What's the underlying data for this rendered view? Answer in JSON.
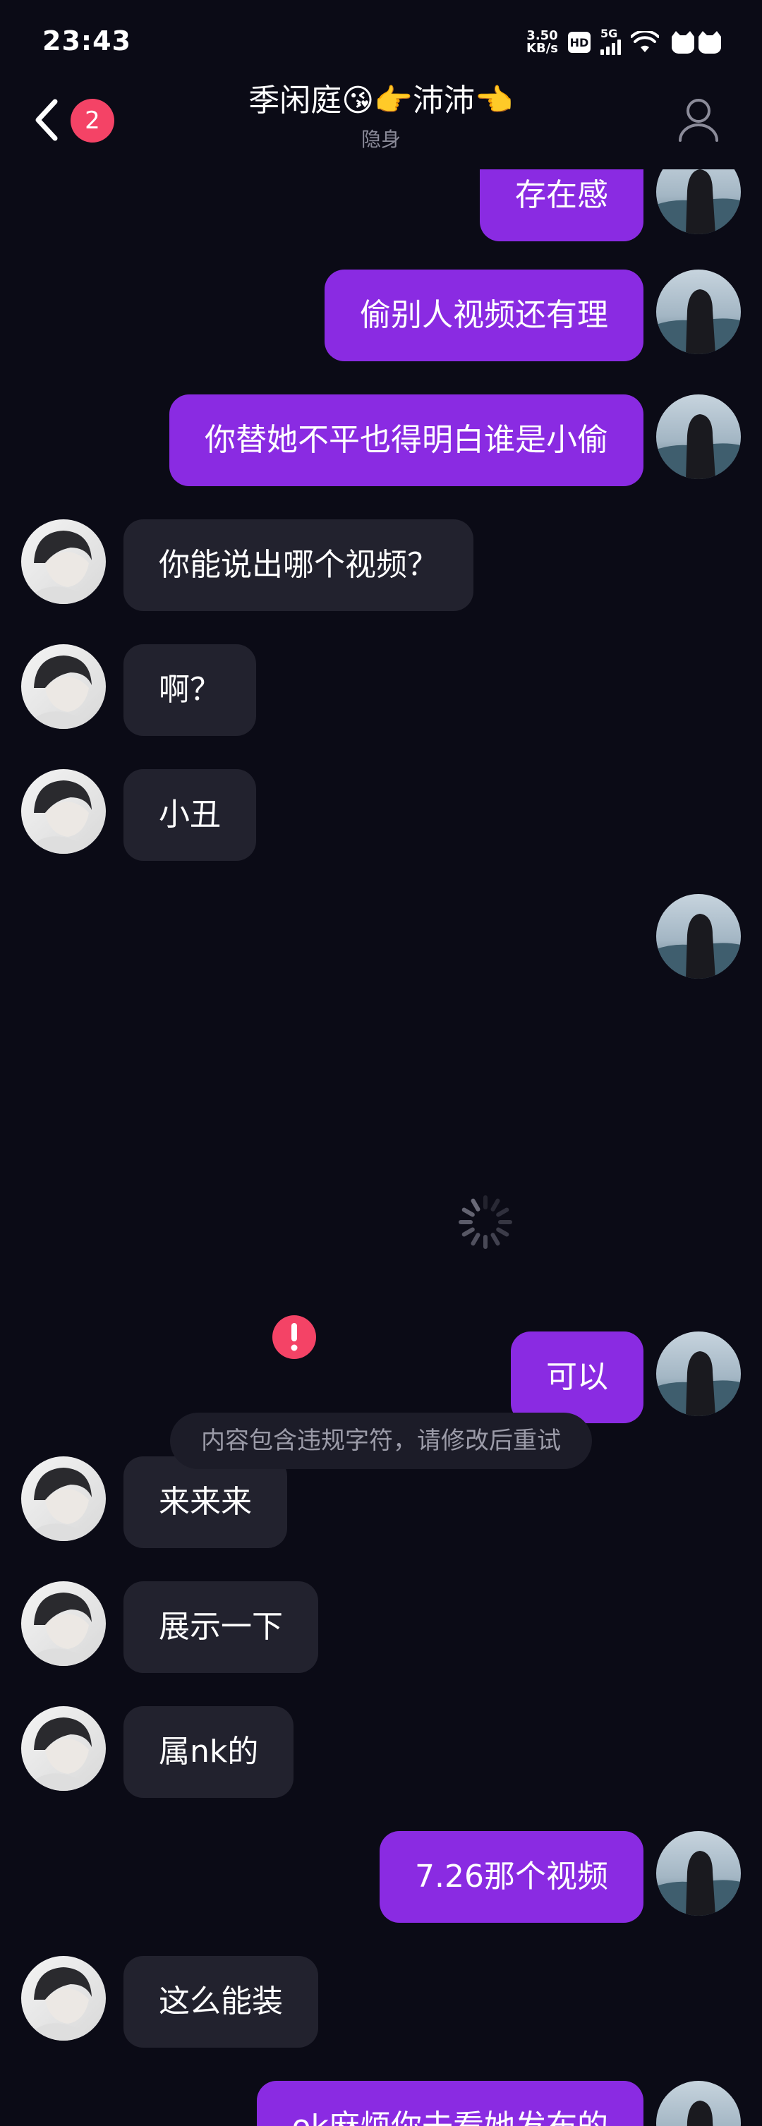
{
  "status_bar": {
    "time": "23:43",
    "net_speed_value": "3.50",
    "net_speed_unit": "KB/s",
    "hd_label": "HD",
    "network_type": "5G"
  },
  "header": {
    "unread_count": "2",
    "title": "季闲庭😘👉沛沛👈",
    "subtitle": "隐身"
  },
  "messages": [
    {
      "from": "self",
      "text": "存在感"
    },
    {
      "from": "self",
      "text": "偷别人视频还有理"
    },
    {
      "from": "self",
      "text": "你替她不平也得明白谁是小偷"
    },
    {
      "from": "other",
      "text": "你能说出哪个视频？"
    },
    {
      "from": "other",
      "text": "啊？"
    },
    {
      "from": "other",
      "text": "小丑"
    },
    {
      "from": "self",
      "text": "可以"
    },
    {
      "from": "other",
      "text": "来来来"
    },
    {
      "from": "other",
      "text": "展示一下"
    },
    {
      "from": "other",
      "text": "属nk的"
    },
    {
      "from": "self",
      "text": "7.26那个视频"
    },
    {
      "from": "other",
      "text": "这么能装"
    },
    {
      "from": "self",
      "text": "ok麻烦你去看她发布的"
    }
  ],
  "system_notice": "内容包含违规字符，请修改后重试",
  "colors": {
    "background": "#0b0b16",
    "self_bubble": "#8a2be2",
    "other_bubble": "#22222e",
    "badge": "#f44366",
    "notice_text": "#9b9ba8"
  },
  "icons": [
    "back-arrow-icon",
    "profile-icon",
    "wifi-icon",
    "signal-icon",
    "loading-spinner-icon",
    "error-icon"
  ]
}
